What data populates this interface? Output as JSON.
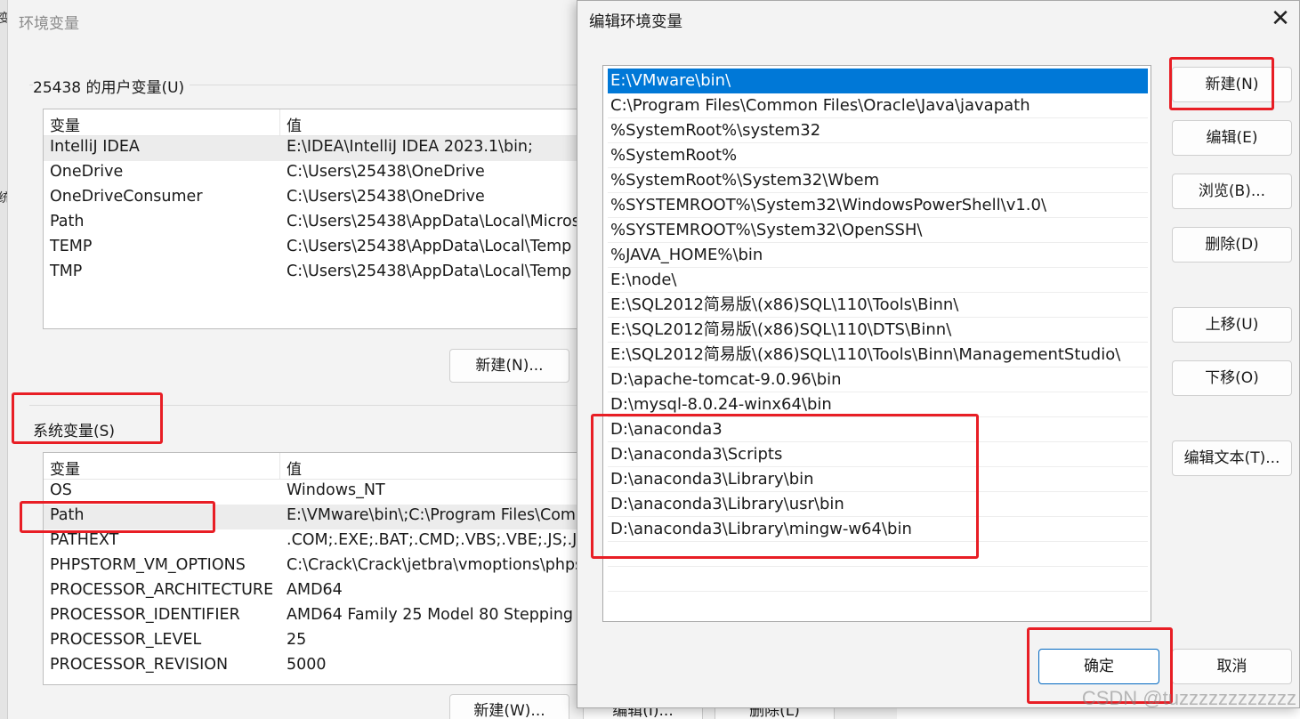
{
  "background_window": {
    "title": "环境变量",
    "edge_chars": [
      "变",
      "统"
    ],
    "user_vars": {
      "label": "25438 的用户变量(U)",
      "headers": [
        "变量",
        "值"
      ],
      "rows": [
        [
          "IntelliJ IDEA",
          "E:\\IDEA\\IntelliJ IDEA 2023.1\\bin;"
        ],
        [
          "OneDrive",
          "C:\\Users\\25438\\OneDrive"
        ],
        [
          "OneDriveConsumer",
          "C:\\Users\\25438\\OneDrive"
        ],
        [
          "Path",
          "C:\\Users\\25438\\AppData\\Local\\Micros"
        ],
        [
          "TEMP",
          "C:\\Users\\25438\\AppData\\Local\\Temp"
        ],
        [
          "TMP",
          "C:\\Users\\25438\\AppData\\Local\\Temp"
        ]
      ],
      "new_button": "新建(N)..."
    },
    "system_vars": {
      "label": "系统变量(S)",
      "headers": [
        "变量",
        "值"
      ],
      "rows": [
        [
          "OS",
          "Windows_NT"
        ],
        [
          "Path",
          "E:\\VMware\\bin\\;C:\\Program Files\\Com"
        ],
        [
          "PATHEXT",
          ".COM;.EXE;.BAT;.CMD;.VBS;.VBE;.JS;.JSE;"
        ],
        [
          "PHPSTORM_VM_OPTIONS",
          "C:\\Crack\\Crack\\jetbra\\vmoptions\\phps"
        ],
        [
          "PROCESSOR_ARCHITECTURE",
          "AMD64"
        ],
        [
          "PROCESSOR_IDENTIFIER",
          "AMD64 Family 25 Model 80 Stepping"
        ],
        [
          "PROCESSOR_LEVEL",
          "25"
        ],
        [
          "PROCESSOR_REVISION",
          "5000"
        ]
      ],
      "new_button": "新建(W)...",
      "edit_button": "编辑(I)...",
      "delete_button": "删除(L)"
    }
  },
  "dialog": {
    "title": "编辑环境变量",
    "close_icon": "close-icon",
    "paths": [
      "E:\\VMware\\bin\\",
      "C:\\Program Files\\Common Files\\Oracle\\Java\\javapath",
      "%SystemRoot%\\system32",
      "%SystemRoot%",
      "%SystemRoot%\\System32\\Wbem",
      "%SYSTEMROOT%\\System32\\WindowsPowerShell\\v1.0\\",
      "%SYSTEMROOT%\\System32\\OpenSSH\\",
      "%JAVA_HOME%\\bin",
      "E:\\node\\",
      "E:\\SQL2012简易版\\(x86)SQL\\110\\Tools\\Binn\\",
      "E:\\SQL2012简易版\\(x86)SQL\\110\\DTS\\Binn\\",
      "E:\\SQL2012简易版\\(x86)SQL\\110\\Tools\\Binn\\ManagementStudio\\",
      "D:\\apache-tomcat-9.0.96\\bin",
      "D:\\mysql-8.0.24-winx64\\bin",
      "D:\\anaconda3",
      "D:\\anaconda3\\Scripts",
      "D:\\anaconda3\\Library\\bin",
      "D:\\anaconda3\\Library\\usr\\bin",
      "D:\\anaconda3\\Library\\mingw-w64\\bin",
      "",
      ""
    ],
    "selected_index": 0,
    "buttons": {
      "new": "新建(N)",
      "edit": "编辑(E)",
      "browse": "浏览(B)...",
      "delete": "删除(D)",
      "move_up": "上移(U)",
      "move_down": "下移(O)",
      "edit_text": "编辑文本(T)...",
      "ok": "确定",
      "cancel": "取消"
    }
  },
  "watermark": "CSDN @tuzzzzzzzzzzzz",
  "colors": {
    "highlight": "#e81e25",
    "selection": "#0078d7"
  }
}
